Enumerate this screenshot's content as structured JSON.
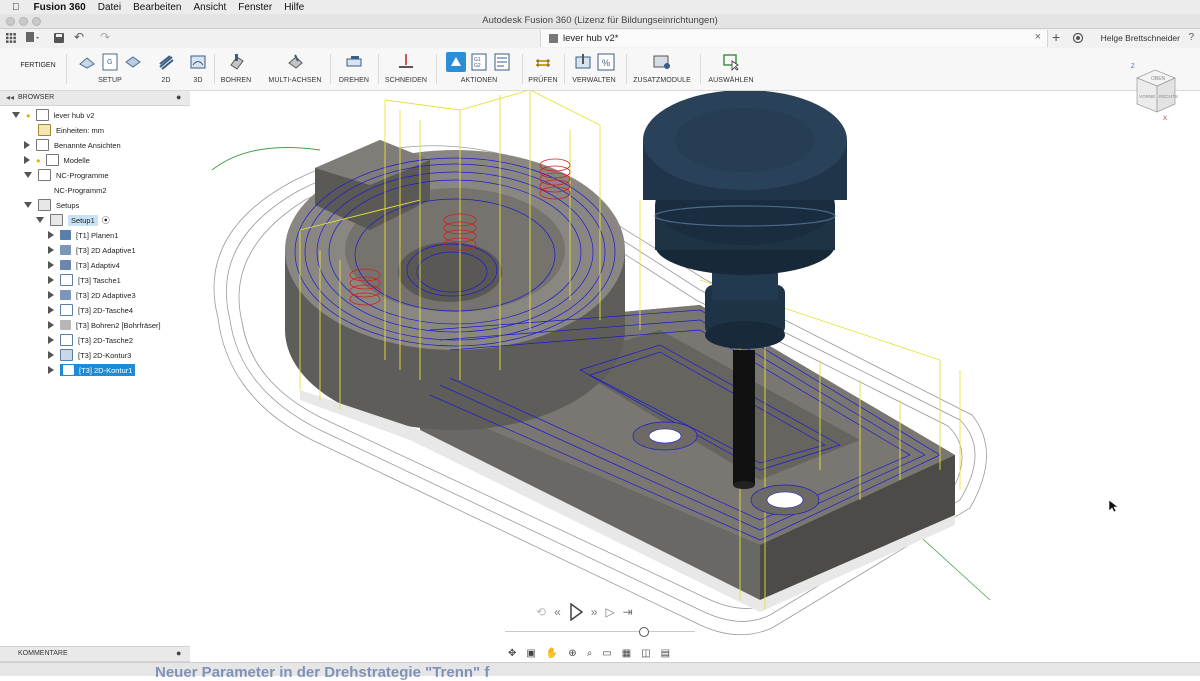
{
  "menubar": {
    "app_name": "Fusion 360",
    "items": [
      "Datei",
      "Bearbeiten",
      "Ansicht",
      "Fenster",
      "Hilfe"
    ]
  },
  "window": {
    "title": "Autodesk Fusion 360 (Lizenz für Bildungseinrichtungen)"
  },
  "document_tab": {
    "name": "lever hub v2*"
  },
  "user": {
    "name": "Helge Brettschneider"
  },
  "workspace": {
    "label": "FERTIGEN"
  },
  "ribbon": {
    "groups": [
      {
        "label": "SETUP",
        "icon": "setup-icon"
      },
      {
        "label": "2D",
        "icon": "2d-milling-icon"
      },
      {
        "label": "3D",
        "icon": "3d-milling-icon"
      },
      {
        "label": "BOHREN",
        "icon": "drill-icon"
      },
      {
        "label": "MULTI-ACHSEN",
        "icon": "multi-axis-icon"
      },
      {
        "label": "DREHEN",
        "icon": "turning-icon"
      },
      {
        "label": "SCHNEIDEN",
        "icon": "cutting-icon"
      },
      {
        "label": "AKTIONEN",
        "icon": "actions-icon"
      },
      {
        "label": "PRÜFEN",
        "icon": "inspect-icon"
      },
      {
        "label": "VERWALTEN",
        "icon": "manage-icon"
      },
      {
        "label": "ZUSATZMODULE",
        "icon": "addins-icon"
      },
      {
        "label": "AUSWÄHLEN",
        "icon": "select-icon"
      }
    ]
  },
  "browser": {
    "title": "BROWSER",
    "tree": [
      {
        "label": "lever hub v2",
        "level": 0,
        "expanded": true,
        "icon": "document-icon"
      },
      {
        "label": "Einheiten: mm",
        "level": 1,
        "icon": "units-icon"
      },
      {
        "label": "Benannte Ansichten",
        "level": 1,
        "expanded": false,
        "icon": "folder-icon"
      },
      {
        "label": "Modelle",
        "level": 1,
        "expanded": false,
        "icon": "model-icon"
      },
      {
        "label": "NC-Programme",
        "level": 1,
        "expanded": true,
        "icon": "nc-programs-icon"
      },
      {
        "label": "NC-Programm2",
        "level": 2,
        "icon": "nc-program-icon"
      },
      {
        "label": "Setups",
        "level": 1,
        "expanded": true,
        "icon": "folder-icon"
      },
      {
        "label": "Setup1",
        "level": 2,
        "expanded": true,
        "icon": "setup-folder-icon",
        "state": "active"
      },
      {
        "label": "[T1] Planen1",
        "level": 3,
        "icon": "facing-icon"
      },
      {
        "label": "[T3] 2D Adaptive1",
        "level": 3,
        "icon": "adaptive-icon"
      },
      {
        "label": "[T3] Adaptiv4",
        "level": 3,
        "icon": "adaptive-icon"
      },
      {
        "label": "[T3] Tasche1",
        "level": 3,
        "icon": "pocket-icon"
      },
      {
        "label": "[T3] 2D Adaptive3",
        "level": 3,
        "icon": "adaptive-icon"
      },
      {
        "label": "[T3] 2D-Tasche4",
        "level": 3,
        "icon": "pocket-icon"
      },
      {
        "label": "[T3] Bohren2 [Bohrfräser]",
        "level": 3,
        "icon": "bore-icon"
      },
      {
        "label": "[T3] 2D-Tasche2",
        "level": 3,
        "icon": "pocket-icon"
      },
      {
        "label": "[T3] 2D-Kontur3",
        "level": 3,
        "icon": "contour-icon"
      },
      {
        "label": "[T3] 2D-Kontur1",
        "level": 3,
        "icon": "contour-icon",
        "state": "selected"
      }
    ]
  },
  "comments": {
    "title": "KOMMENTARE"
  },
  "viewcube": {
    "faces": [
      "OBEN",
      "VORNE",
      "RECHTS"
    ],
    "axes": [
      "Z",
      "X"
    ]
  },
  "overlay": {
    "text": "Neuer Parameter in der Drehstrategie \"Trenn\" f"
  },
  "colors": {
    "accent": "#1f8ad6",
    "part": "#6b6964",
    "toolpath_blue": "#1a1ad0",
    "toolpath_yellow": "#e6e23a",
    "toolpath_red": "#d0201a",
    "tool_holder": "#1f3347"
  }
}
